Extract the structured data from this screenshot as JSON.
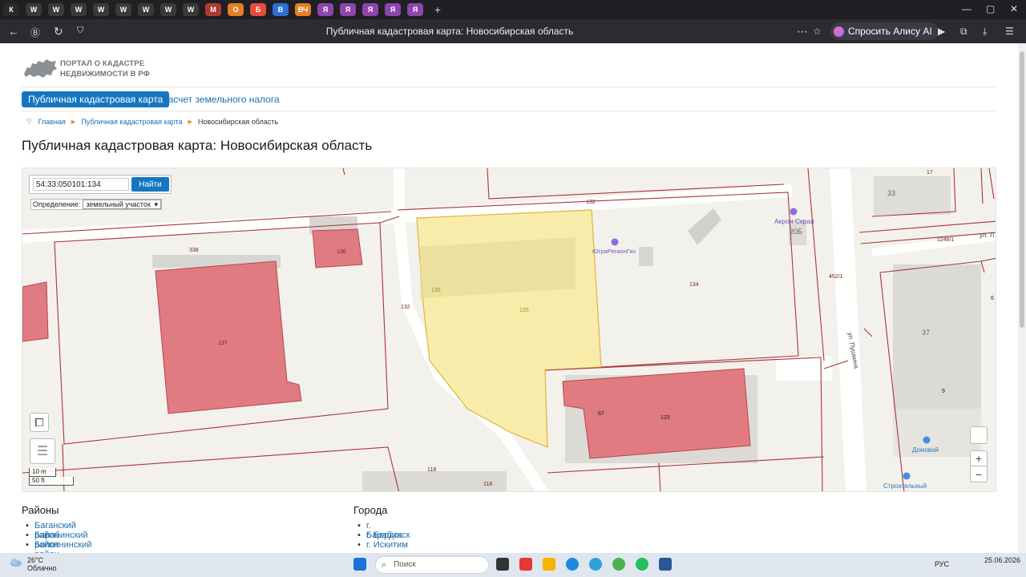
{
  "browser": {
    "title": "Публичная кадастровая карта: Новосибирская область",
    "alisa_label": "Спросить Алису AI",
    "tabs": [
      "К",
      "W",
      "W",
      "W",
      "W",
      "W",
      "W",
      "W",
      "W",
      "M",
      "O",
      "Б",
      "В",
      "ВЧ",
      "Я",
      "Я",
      "Я",
      "Я",
      "Я"
    ],
    "new_tab": "+"
  },
  "site": {
    "logo_line1": "ПОРТАЛ О КАДАСТРЕ",
    "logo_line2": "НЕДВИЖИМОСТИ В РФ",
    "menu_active": "Публичная кадастровая карта",
    "menu_link": "Расчет земельного налога",
    "breadcrumbs": [
      "Главная",
      "Публичная кадастровая карта",
      "Новосибирская область"
    ],
    "heading": "Публичная кадастровая карта: Новосибирская область"
  },
  "map": {
    "search_value": "54:33:050101:134",
    "search_button": "Найти",
    "definition_label": "Определение:",
    "definition_value": "земельный участок",
    "scale_m": "10 m",
    "scale_ft": "50 ft",
    "zoom_in": "+",
    "zoom_out": "−",
    "parcel_labels": {
      "p338": "338",
      "p136": "136",
      "p137": "137",
      "p132a": "132",
      "p132b": "132",
      "p135a": "135",
      "p135b": "135",
      "p134": "134",
      "p87": "87",
      "p123": "123",
      "p118a": "118",
      "p118b": "118",
      "p17": "17",
      "p33": "33",
      "p1246": "1246/1",
      "p452": "452/1",
      "p37": "37",
      "p9": "9",
      "p20b": "20Б",
      "p6": "6"
    },
    "poi": {
      "akron": "Акрон Скрап",
      "yugra": "ЮграРегионГаз",
      "domovoy": "Домовой",
      "stroitel": "Строительный",
      "street_pushkina": "ул. Пушкина",
      "street_l": "ул. Л"
    }
  },
  "districts": {
    "heading": "Районы",
    "items": [
      "Баганский район",
      "Барабинский район",
      "Болотнинский район"
    ]
  },
  "cities": {
    "heading": "Города",
    "items": [
      "г. Барабинск",
      "г. Бердск",
      "г. Искитим"
    ]
  },
  "taskbar": {
    "temperature": "26°C",
    "weather": "Облачно",
    "search_placeholder": "Поиск",
    "lang": "РУС",
    "date": "25.06.2026"
  },
  "colors": {
    "accent": "#1476c1",
    "parcel_fill": "#e07b82",
    "selected_fill": "#f7eb9e",
    "boundary": "#a8363b"
  }
}
